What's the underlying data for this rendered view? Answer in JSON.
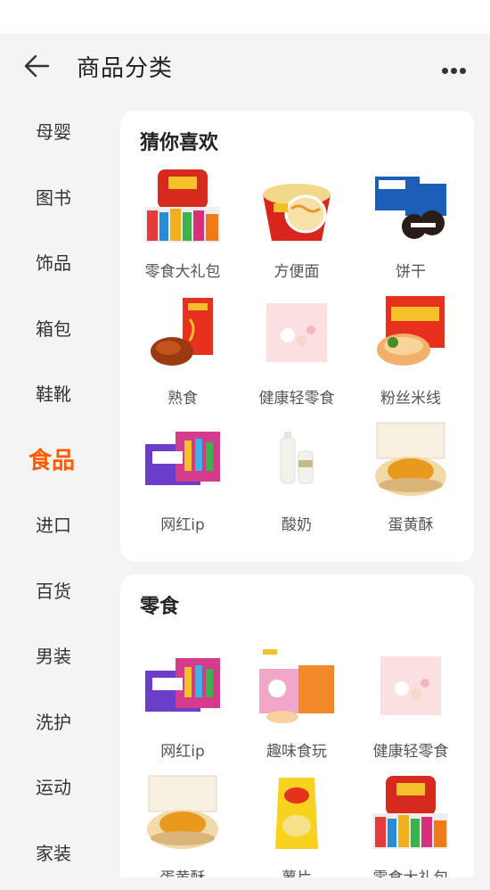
{
  "header": {
    "title": "商品分类"
  },
  "sidebar": {
    "items": [
      {
        "label": "母婴"
      },
      {
        "label": "图书"
      },
      {
        "label": "饰品"
      },
      {
        "label": "箱包"
      },
      {
        "label": "鞋靴"
      },
      {
        "label": "食品"
      },
      {
        "label": "进口"
      },
      {
        "label": "百货"
      },
      {
        "label": "男装"
      },
      {
        "label": "洗护"
      },
      {
        "label": "运动"
      },
      {
        "label": "家装"
      }
    ],
    "active": "食品"
  },
  "sections": [
    {
      "title": "猜你喜欢",
      "items": [
        {
          "label": "零食大礼包",
          "icon": "snack-gift-pack-image"
        },
        {
          "label": "方便面",
          "icon": "instant-noodles-image"
        },
        {
          "label": "饼干",
          "icon": "cookies-image"
        },
        {
          "label": "熟食",
          "icon": "roast-duck-image"
        },
        {
          "label": "健康轻零食",
          "icon": "healthy-snack-image"
        },
        {
          "label": "粉丝米线",
          "icon": "rice-noodles-image"
        },
        {
          "label": "网红ip",
          "icon": "internet-snack-box-image"
        },
        {
          "label": "酸奶",
          "icon": "yogurt-image"
        },
        {
          "label": "蛋黄酥",
          "icon": "egg-yolk-pastry-image"
        }
      ]
    },
    {
      "title": "零食",
      "items": [
        {
          "label": "网红ip",
          "icon": "internet-snack-box-image"
        },
        {
          "label": "趣味食玩",
          "icon": "fun-food-toy-image"
        },
        {
          "label": "健康轻零食",
          "icon": "healthy-snack-image"
        },
        {
          "label": "蛋黄酥",
          "icon": "egg-yolk-pastry-image"
        },
        {
          "label": "薯片",
          "icon": "potato-chips-image"
        },
        {
          "label": "零食大礼包",
          "icon": "snack-gift-pack-image"
        }
      ]
    }
  ],
  "colors": {
    "accent": "#ff5a00",
    "background": "#f4f4f4",
    "card": "#ffffff"
  }
}
